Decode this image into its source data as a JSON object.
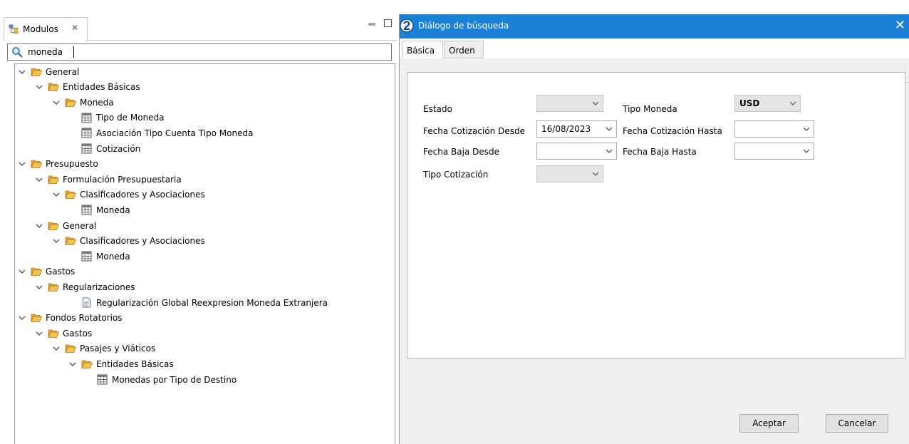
{
  "modulos": {
    "tab_label": "Modulos",
    "close_glyph": "✕",
    "search_value": "moneda",
    "tree": [
      {
        "label": "General",
        "level": 0,
        "type": "folder"
      },
      {
        "label": "Entidades Básicas",
        "level": 1,
        "type": "folder"
      },
      {
        "label": "Moneda",
        "level": 2,
        "type": "folder"
      },
      {
        "label": "Tipo de Moneda",
        "level": 3,
        "type": "table"
      },
      {
        "label": "Asociación Tipo Cuenta Tipo Moneda",
        "level": 3,
        "type": "table"
      },
      {
        "label": "Cotización",
        "level": 3,
        "type": "table"
      },
      {
        "label": "Presupuesto",
        "level": 0,
        "type": "folder"
      },
      {
        "label": "Formulación Presupuestaria",
        "level": 1,
        "type": "folder"
      },
      {
        "label": "Clasificadores y Asociaciones",
        "level": 2,
        "type": "folder"
      },
      {
        "label": "Moneda",
        "level": 3,
        "type": "table"
      },
      {
        "label": "General",
        "level": 1,
        "type": "folder"
      },
      {
        "label": "Clasificadores y Asociaciones",
        "level": 2,
        "type": "folder"
      },
      {
        "label": "Moneda",
        "level": 3,
        "type": "table"
      },
      {
        "label": "Gastos",
        "level": 0,
        "type": "folder"
      },
      {
        "label": "Regularizaciones",
        "level": 1,
        "type": "folder"
      },
      {
        "label": "Regularización Global Reexpresion Moneda Extranjera",
        "level": 3,
        "type": "form"
      },
      {
        "label": "Fondos Rotatorios",
        "level": 0,
        "type": "folder"
      },
      {
        "label": "Gastos",
        "level": 1,
        "type": "folder"
      },
      {
        "label": "Pasajes y Viáticos",
        "level": 2,
        "type": "folder"
      },
      {
        "label": "Entidades Básicas",
        "level": 3,
        "type": "folder"
      },
      {
        "label": "Monedas por Tipo de Destino",
        "level": 4,
        "type": "table"
      }
    ]
  },
  "dialog": {
    "title": "Diálogo de búsqueda",
    "close_glyph": "✕",
    "tabs": [
      "Básica",
      "Orden"
    ],
    "fields": {
      "estado": {
        "label": "Estado",
        "value": ""
      },
      "tipo_moneda": {
        "label": "Tipo Moneda",
        "value": "USD"
      },
      "fecha_cot_desde": {
        "label": "Fecha Cotización Desde",
        "value": "16/08/2023"
      },
      "fecha_cot_hasta": {
        "label": "Fecha Cotización Hasta",
        "value": ""
      },
      "fecha_baja_desde": {
        "label": "Fecha Baja Desde",
        "value": ""
      },
      "fecha_baja_hasta": {
        "label": "Fecha Baja Hasta",
        "value": ""
      },
      "tipo_cotizacion": {
        "label": "Tipo Cotización",
        "value": ""
      }
    },
    "buttons": {
      "accept": "Aceptar",
      "cancel": "Cancelar"
    }
  },
  "colors": {
    "titlebar": "#1a81d6",
    "folder": "#f3c24f"
  }
}
